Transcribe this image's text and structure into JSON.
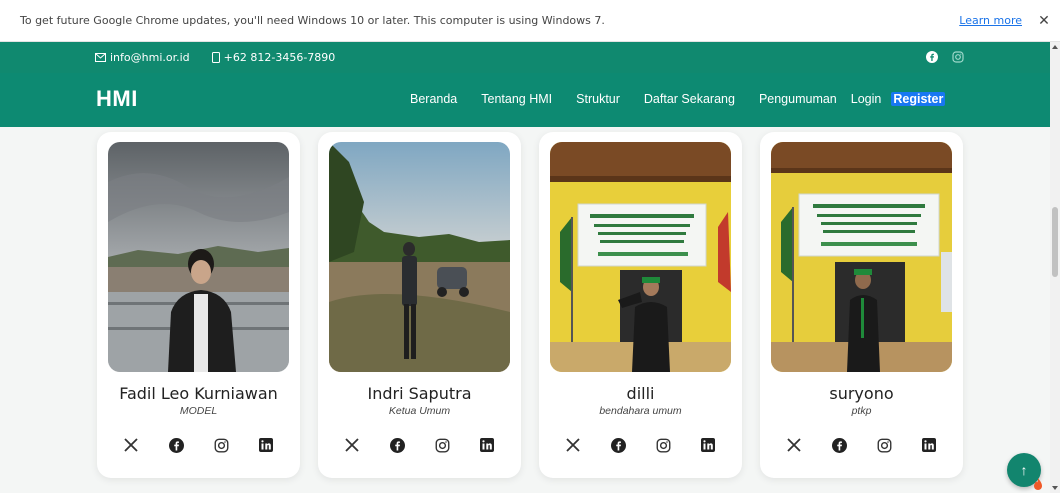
{
  "infobar": {
    "message": "To get future Google Chrome updates, you'll need Windows 10 or later. This computer is using Windows 7.",
    "learn_more": "Learn more",
    "close": "✕"
  },
  "topbar": {
    "email": "info@hmi.or.id",
    "phone": "+62 812-3456-7890",
    "icons": [
      "facebook-icon",
      "instagram-icon"
    ]
  },
  "navbar": {
    "brand": "HMI",
    "menu": [
      "Beranda",
      "Tentang HMI",
      "Struktur",
      "Daftar Sekarang",
      "Pengumuman",
      "Login"
    ],
    "register": "Register"
  },
  "members": [
    {
      "name": "Fadil Leo Kurniawan",
      "role": "MODEL"
    },
    {
      "name": "Indri Saputra",
      "role": "Ketua Umum"
    },
    {
      "name": "dilli",
      "role": "bendahara umum"
    },
    {
      "name": "suryono",
      "role": "ptkp"
    }
  ],
  "social_icons": [
    "x-icon",
    "facebook-icon",
    "instagram-icon",
    "linkedin-icon"
  ],
  "colors": {
    "brand_green": "#0d8a72",
    "register_blue": "#1877f2",
    "accent_link": "#1a73e8"
  },
  "back_to_top": "↑"
}
